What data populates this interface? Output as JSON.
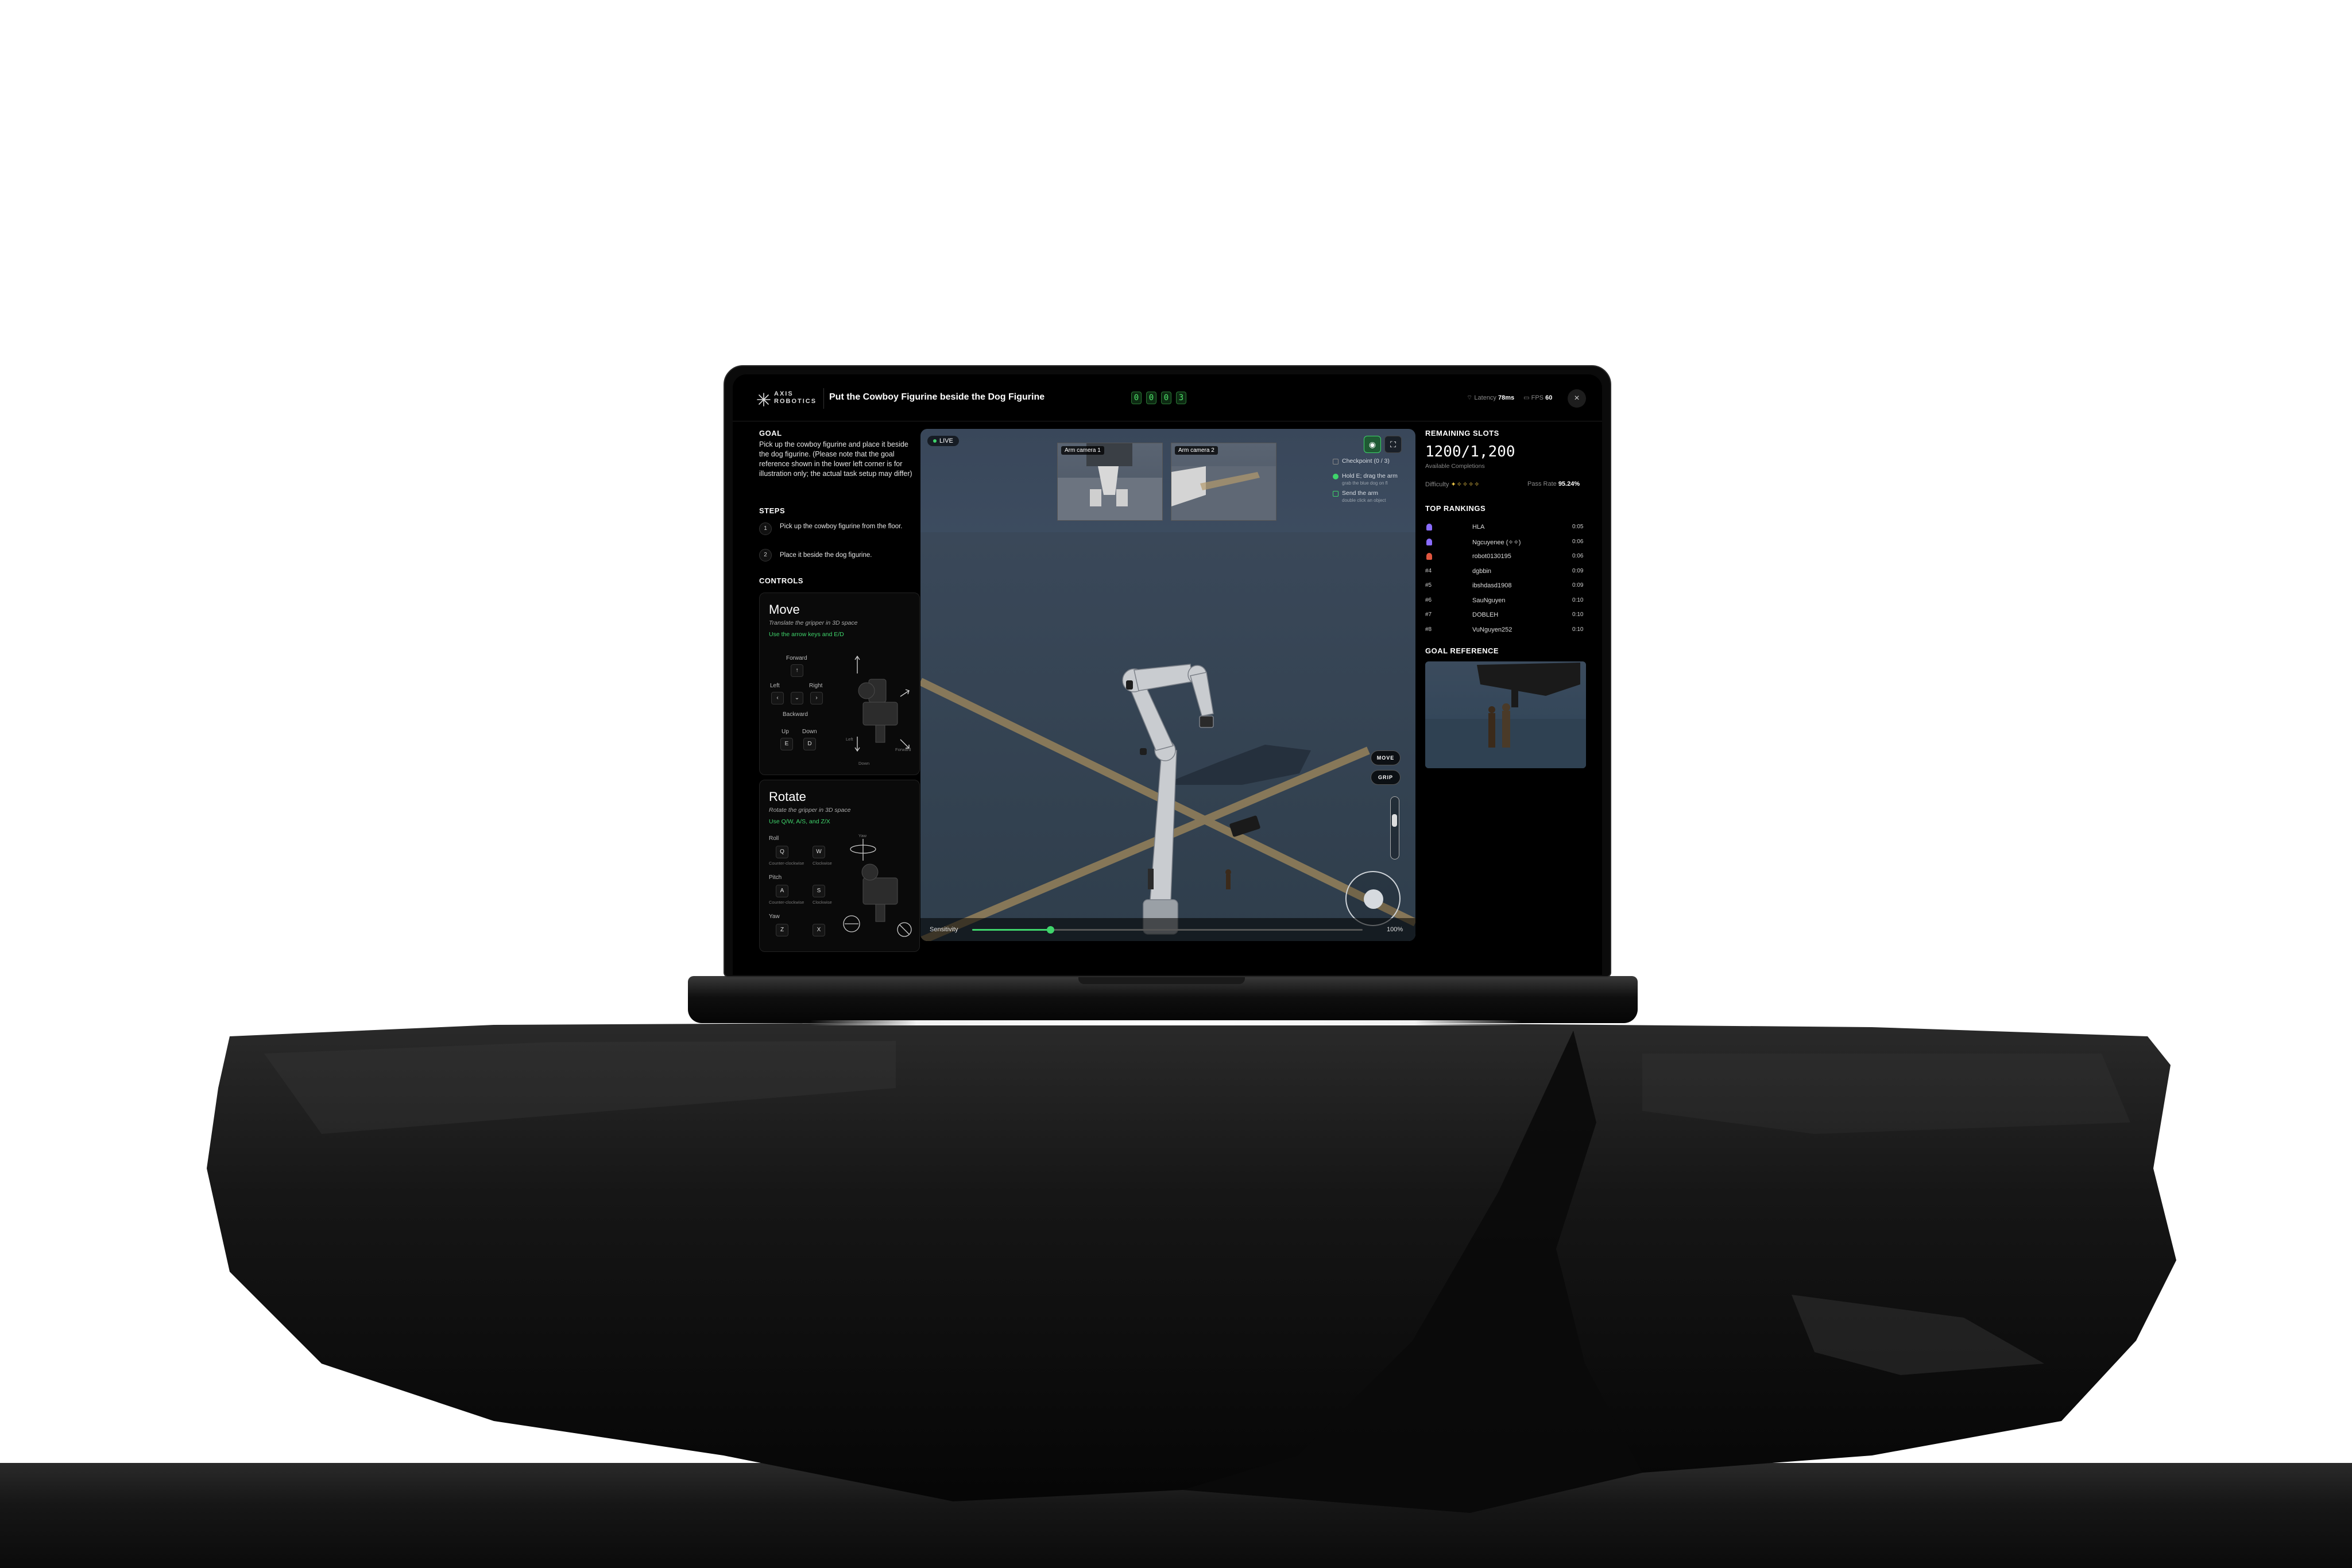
{
  "app": {
    "brand": "AXIS ROBOTICS",
    "task_title": "Put the Cowboy Figurine beside the Dog Figurine",
    "timer_digits": [
      "0",
      "0",
      "0",
      "3"
    ],
    "latency_label": "Latency",
    "latency_value": "78ms",
    "fps_label": "FPS",
    "fps_value": "60",
    "close_label": "×"
  },
  "goal": {
    "title": "GOAL",
    "text": "Pick up the cowboy figurine and place it beside the dog figurine. (Please note that the goal reference shown in the lower left corner is for illustration only; the actual task setup may differ)"
  },
  "steps": {
    "title": "STEPS",
    "items": [
      {
        "num": "1",
        "text": "Pick up the cowboy figurine from the floor."
      },
      {
        "num": "2",
        "text": "Place it beside the dog figurine."
      }
    ]
  },
  "controls": {
    "title": "CONTROLS",
    "move": {
      "title": "Move",
      "subtitle": "Translate the gripper in 3D space",
      "hint": "Use the arrow keys and E/D",
      "forward": "Forward",
      "left": "Left",
      "right": "Right",
      "backward": "Backward",
      "up": "Up",
      "down": "Down",
      "key_up": "↑",
      "key_left": "‹",
      "key_down": "⌄",
      "key_right": "›",
      "key_e": "E",
      "key_d": "D",
      "diagram_forward": "Forward",
      "diagram_down": "Down",
      "diagram_left": "Left"
    },
    "rotate": {
      "title": "Rotate",
      "subtitle": "Rotate the gripper in 3D space",
      "hint": "Use Q/W, A/S, and Z/X",
      "yaw_top": "Yaw",
      "roll": "Roll",
      "pitch": "Pitch",
      "yaw": "Yaw",
      "key_q": "Q",
      "key_w": "W",
      "key_a": "A",
      "key_s": "S",
      "key_z": "Z",
      "key_x": "X",
      "roll_ccw": "Counter-clockwise",
      "roll_cw": "Clockwise",
      "pitch_ccw": "Counter-clockwise",
      "pitch_cw": "Clockwise"
    }
  },
  "viewport": {
    "live": "LIVE",
    "cam1": "Arm camera 1",
    "cam2": "Arm camera 2",
    "checkpoints": [
      {
        "title": "Checkpoint (0 / 3)",
        "sub": ""
      },
      {
        "title": "Hold E; drag the arm",
        "sub": "grab the blue dog on fl"
      },
      {
        "title": "Send the arm",
        "sub": "double click an object"
      }
    ],
    "mode_move": "MOVE",
    "mode_grip": "GRIP",
    "sensitivity_label": "Sensitivity",
    "sensitivity_value": "100%",
    "sensitivity_fraction": 0.2
  },
  "right": {
    "slots_title": "REMAINING SLOTS",
    "slots_value": "1200/1,200",
    "slots_sub": "Available Completions",
    "difficulty_label": "Difficulty",
    "difficulty_stars": "✦✧✧✧✧",
    "pass_label": "Pass Rate",
    "pass_value": "95.24%",
    "rankings_title": "TOP RANKINGS",
    "rankings": [
      {
        "pos": "",
        "name": "HLA",
        "time": "0:05",
        "medal": "#8a6cff"
      },
      {
        "pos": "",
        "name": "Ngcuyenee (✧✧)",
        "time": "0:06",
        "medal": "#8a6cff"
      },
      {
        "pos": "",
        "name": "robot0130195",
        "time": "0:06",
        "medal": "#e0563f"
      },
      {
        "pos": "#4",
        "name": "dgbbin",
        "time": "0:09",
        "medal": ""
      },
      {
        "pos": "#5",
        "name": "ibshdasd1908",
        "time": "0:09",
        "medal": ""
      },
      {
        "pos": "#6",
        "name": "SauNguyen",
        "time": "0:10",
        "medal": ""
      },
      {
        "pos": "#7",
        "name": "DOBLEH",
        "time": "0:10",
        "medal": ""
      },
      {
        "pos": "#8",
        "name": "VuNguyen252",
        "time": "0:10",
        "medal": ""
      }
    ],
    "goal_ref_title": "GOAL REFERENCE"
  },
  "colors": {
    "accent": "#3fd46b",
    "gold": "#f0c84a",
    "viewport_bg": "#3e4e62"
  }
}
